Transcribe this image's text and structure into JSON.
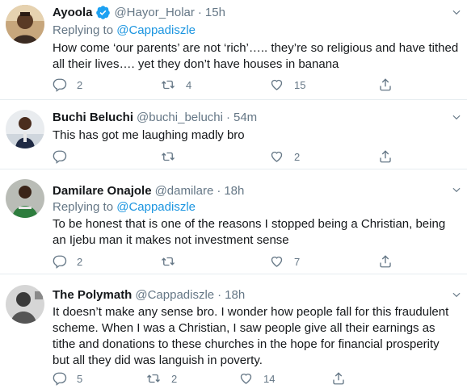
{
  "tweets": [
    {
      "name": "Ayoola",
      "verified": true,
      "handle": "@Hayor_Holar",
      "dot": "·",
      "time": "15h",
      "replying_label": "Replying to",
      "replying_to": "@Cappadiszle",
      "text": "How come ‘our parents’ are not ‘rich’….. they’re so religious and have tithed all their lives…. yet they don’t have houses in banana",
      "replies": "2",
      "retweets": "4",
      "likes": "15"
    },
    {
      "name": "Buchi Beluchi",
      "verified": false,
      "handle": "@buchi_beluchi",
      "dot": "·",
      "time": "54m",
      "text": "This has got me laughing madly bro",
      "replies": "",
      "retweets": "",
      "likes": "2"
    },
    {
      "name": "Damilare Onajole",
      "verified": false,
      "handle": "@damilare",
      "dot": "·",
      "time": "18h",
      "replying_label": "Replying to",
      "replying_to": "@Cappadiszle",
      "text": "To be honest that is one of the reasons I stopped being a Christian, being an Ijebu man it makes not investment sense",
      "replies": "2",
      "retweets": "",
      "likes": "7"
    },
    {
      "name": "The Polymath",
      "verified": false,
      "handle": "@Cappadiszle",
      "dot": "·",
      "time": "18h",
      "text": "It doesn’t make any sense bro. I wonder how people fall for this fraudulent scheme. When I was a Christian, I saw people give all their earnings as tithe and donations to these churches in the hope for financial prosperity but all they did was languish in poverty.",
      "replies": "5",
      "retweets": "2",
      "likes": "14"
    }
  ],
  "icons": {
    "reply": "reply-icon",
    "retweet": "retweet-icon",
    "like": "like-icon",
    "share": "share-icon",
    "caret": "chevron-down-icon",
    "verified": "verified-badge-icon"
  },
  "colors": {
    "text": "#14171a",
    "muted": "#657786",
    "link": "#1b95e0",
    "verified": "#1da1f2",
    "divider": "#e6ecf0"
  }
}
